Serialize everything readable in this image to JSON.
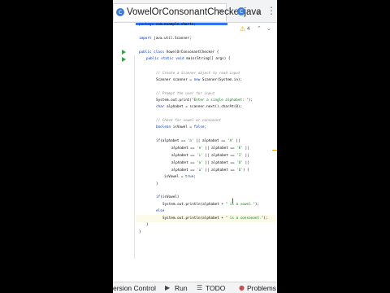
{
  "editor": {
    "active_tab": {
      "label": "VowelOrConsonantChecker.java",
      "icon": "java-class-icon"
    },
    "second_tab": {
      "icon": "java-class-icon"
    },
    "icons": {
      "tab_icon_glyph": "c",
      "close_glyph": "✕",
      "overflow_glyph": "⌄",
      "more_glyph": "⋮"
    },
    "inspections": {
      "warning_count": "4",
      "warn_glyph": "⚠",
      "up_glyph": "⌃",
      "down_glyph": "⌄"
    }
  },
  "code": {
    "l1": {
      "kw": "package",
      "rest": " com.example.shorts;"
    },
    "l2": {
      "kw": "import",
      "rest": " java.util.Scanner;"
    },
    "l3": {
      "kw": "public class",
      "rest": " VowelOrConsonantChecker {"
    },
    "l4": {
      "kw": "public static void",
      "rest": " main(String[] args) {"
    },
    "l5": {
      "cm": "// Create a Scanner object to read input"
    },
    "l6": {
      "rest": "Scanner scanner = ",
      "kw": "new",
      "rest2": " Scanner(System.in);"
    },
    "l7": {
      "cm": "// Prompt the user for input"
    },
    "l8": {
      "rest": "System.out.print(",
      "str": "\"Enter a single alphabet: \"",
      "rest2": ");"
    },
    "l9": {
      "kw": "char",
      "rest": " alphabet = scanner.next().charAt(0);"
    },
    "l10": {
      "cm": "// Check for vowel or consonant"
    },
    "l11": {
      "kw": "boolean",
      "rest": " isVowel = ",
      "kw2": "false",
      "rest2": ";"
    },
    "l12": {
      "kw": "if",
      "rest": "(alphabet == ",
      "s1": "'a'",
      "mid": " || alphabet == ",
      "s2": "'A'",
      "end": " ||"
    },
    "l13": {
      "rest": "alphabet == ",
      "s1": "'e'",
      "mid": " || alphabet == ",
      "s2": "'E'",
      "end": " ||"
    },
    "l14": {
      "rest": "alphabet == ",
      "s1": "'i'",
      "mid": " || alphabet == ",
      "s2": "'I'",
      "end": " ||"
    },
    "l15": {
      "rest": "alphabet == ",
      "s1": "'o'",
      "mid": " || alphabet == ",
      "s2": "'O'",
      "end": " ||"
    },
    "l16": {
      "rest": "alphabet == ",
      "s1": "'u'",
      "mid": " || alphabet == ",
      "s2": "'U'",
      "end": ") {"
    },
    "l17": {
      "rest": "isVowel = ",
      "kw": "true",
      "rest2": ";"
    },
    "l18": {
      "rest": "}"
    },
    "l19": {
      "kw": "if",
      "rest": "(isVowel)"
    },
    "l20": {
      "rest": "System.out.println(alphabet + ",
      "str": "\" is a vowel.\"",
      "rest2": ");"
    },
    "l21": {
      "kw": "else"
    },
    "l22": {
      "rest": "System.out.println(alphabet + ",
      "str": "\" is a consonant.\"",
      "rest2": ");"
    },
    "l23": {
      "rest": "}"
    },
    "l24": {
      "rest": "}"
    }
  },
  "bottom": {
    "version_control": "ersion Control",
    "run": "Run",
    "todo": "TODO",
    "problems": "Problems",
    "run_glyph": "▶",
    "todo_glyph": "☰",
    "problems_glyph": "●"
  }
}
